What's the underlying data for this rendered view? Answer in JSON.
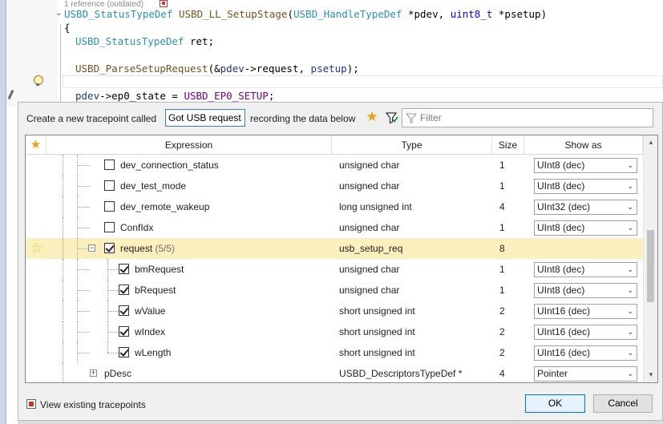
{
  "editor": {
    "codelens": "1 reference (outdated)",
    "lines": {
      "sig_type": "USBD_StatusTypeDef",
      "sig_fn": "USBD_LL_SetupStage",
      "sig_paren_open": "(",
      "sig_p1_type": "USBD_HandleTypeDef",
      "sig_p1_name": " *pdev, ",
      "sig_p2_type": "uint8_t",
      "sig_p2_name": " *psetup",
      "sig_paren_close": ")",
      "brace": "{",
      "decl_type": "USBD_StatusTypeDef",
      "decl_rest": " ret;",
      "call_fn": "USBD_ParseSetupRequest",
      "call_open": "(&",
      "call_pdev": "pdev",
      "call_arrow": "->request, ",
      "call_psetup": "psetup",
      "call_close": ");",
      "assign_pdev": "pdev",
      "assign_mid": "->ep0_state = ",
      "assign_mac": "USBD_EP0_SETUP",
      "assign_end": ";"
    }
  },
  "dialog": {
    "create_label": "Create a new tracepoint called",
    "name_value": "Got USB request",
    "recording_label": "recording the data below",
    "filter_placeholder": "Filter",
    "star_icon": "star-icon",
    "funnel_icon": "funnel-icon",
    "columns": {
      "expression": "Expression",
      "type": "Type",
      "size": "Size",
      "show_as": "Show as"
    },
    "rows": [
      {
        "name": "dev_connection_status",
        "count": "",
        "type": "unsigned char",
        "size": "1",
        "show_as": "UInt8 (dec)",
        "checked": false,
        "level": 1,
        "expander": ""
      },
      {
        "name": "dev_test_mode",
        "count": "",
        "type": "unsigned char",
        "size": "1",
        "show_as": "UInt8 (dec)",
        "checked": false,
        "level": 1,
        "expander": ""
      },
      {
        "name": "dev_remote_wakeup",
        "count": "",
        "type": "long unsigned int",
        "size": "4",
        "show_as": "UInt32 (dec)",
        "checked": false,
        "level": 1,
        "expander": ""
      },
      {
        "name": "ConfIdx",
        "count": "",
        "type": "unsigned char",
        "size": "1",
        "show_as": "UInt8 (dec)",
        "checked": false,
        "level": 1,
        "expander": ""
      },
      {
        "name": "request",
        "count": "(5/5)",
        "type": "usb_setup_req",
        "size": "8",
        "show_as": "",
        "checked": true,
        "level": 1,
        "expander": "-",
        "selected": true
      },
      {
        "name": "bmRequest",
        "count": "",
        "type": "unsigned char",
        "size": "1",
        "show_as": "UInt8 (dec)",
        "checked": true,
        "level": 2,
        "expander": ""
      },
      {
        "name": "bRequest",
        "count": "",
        "type": "unsigned char",
        "size": "1",
        "show_as": "UInt8 (dec)",
        "checked": true,
        "level": 2,
        "expander": ""
      },
      {
        "name": "wValue",
        "count": "",
        "type": "short unsigned int",
        "size": "2",
        "show_as": "UInt16 (dec)",
        "checked": true,
        "level": 2,
        "expander": ""
      },
      {
        "name": "wIndex",
        "count": "",
        "type": "short unsigned int",
        "size": "2",
        "show_as": "UInt16 (dec)",
        "checked": true,
        "level": 2,
        "expander": ""
      },
      {
        "name": "wLength",
        "count": "",
        "type": "short unsigned int",
        "size": "2",
        "show_as": "UInt16 (dec)",
        "checked": true,
        "level": 2,
        "expander": ""
      },
      {
        "name": "pDesc",
        "count": "",
        "type": "USBD_DescriptorsTypeDef *",
        "size": "4",
        "show_as": "Pointer",
        "checked": false,
        "level": 0,
        "expander": "+"
      }
    ],
    "view_existing_label": "View existing tracepoints",
    "ok_label": "OK",
    "cancel_label": "Cancel"
  }
}
